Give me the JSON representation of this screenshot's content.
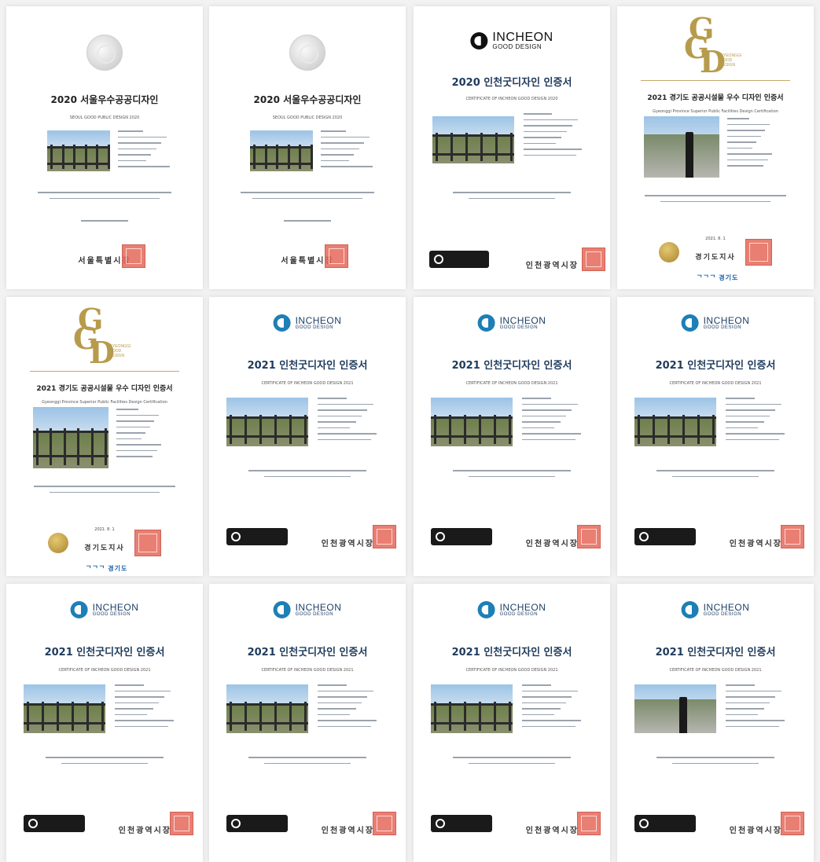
{
  "certificates": [
    {
      "kind": "seoul",
      "title": "2020 서울우수공공디자인",
      "subtitle": "SEOUL GOOD PUBLIC DESIGN 2020",
      "issuer": "서울특별시장"
    },
    {
      "kind": "seoul",
      "title": "2020 서울우수공공디자인",
      "subtitle": "SEOUL GOOD PUBLIC DESIGN 2020",
      "issuer": "서울특별시장"
    },
    {
      "kind": "incheon2020",
      "title": "2020 인천굿디자인 인증서",
      "subtitle": "CERTIFICATE OF INCHEON GOOD DESIGN 2020",
      "issuer": "인천광역시장",
      "logo": "INCHEON",
      "logo_sub": "GOOD DESIGN"
    },
    {
      "kind": "gyeonggi",
      "title": "2021 경기도 공공시설물 우수 디자인 인증서",
      "subtitle": "Gyeonggi Province Superior Public Facilities Design Certification",
      "issuer": "경기도지사",
      "date": "2021. 8. 1",
      "ggg_small": "GYEONGGI GOOD DESIGN",
      "footer_logo": "ᄀᄀᄀ 경기도",
      "photo": "bollard"
    },
    {
      "kind": "gyeonggi",
      "title": "2021 경기도 공공시설물 우수 디자인 인증서",
      "subtitle": "Gyeonggi Province Superior Public Facilities Design Certification",
      "issuer": "경기도지사",
      "date": "2021. 8. 1",
      "ggg_small": "GYEONGGI GOOD DESIGN",
      "footer_logo": "ᄀᄀᄀ 경기도",
      "photo": "fence"
    },
    {
      "kind": "incheon2021",
      "title": "2021 인천굿디자인 인증서",
      "subtitle": "CERTIFICATE OF INCHEON GOOD DESIGN 2021",
      "issuer": "인천광역시장",
      "logo": "INCHEON",
      "logo_sub": "GOOD DESIGN",
      "photo": "fence"
    },
    {
      "kind": "incheon2021",
      "title": "2021 인천굿디자인 인증서",
      "subtitle": "CERTIFICATE OF INCHEON GOOD DESIGN 2021",
      "issuer": "인천광역시장",
      "logo": "INCHEON",
      "logo_sub": "GOOD DESIGN",
      "photo": "fence"
    },
    {
      "kind": "incheon2021",
      "title": "2021 인천굿디자인 인증서",
      "subtitle": "CERTIFICATE OF INCHEON GOOD DESIGN 2021",
      "issuer": "인천광역시장",
      "logo": "INCHEON",
      "logo_sub": "GOOD DESIGN",
      "photo": "fence"
    },
    {
      "kind": "incheon2021",
      "title": "2021 인천굿디자인 인증서",
      "subtitle": "CERTIFICATE OF INCHEON GOOD DESIGN 2021",
      "issuer": "인천광역시장",
      "logo": "INCHEON",
      "logo_sub": "GOOD DESIGN",
      "photo": "fence"
    },
    {
      "kind": "incheon2021",
      "title": "2021 인천굿디자인 인증서",
      "subtitle": "CERTIFICATE OF INCHEON GOOD DESIGN 2021",
      "issuer": "인천광역시장",
      "logo": "INCHEON",
      "logo_sub": "GOOD DESIGN",
      "photo": "fence"
    },
    {
      "kind": "incheon2021",
      "title": "2021 인천굿디자인 인증서",
      "subtitle": "CERTIFICATE OF INCHEON GOOD DESIGN 2021",
      "issuer": "인천광역시장",
      "logo": "INCHEON",
      "logo_sub": "GOOD DESIGN",
      "photo": "fence"
    },
    {
      "kind": "incheon2021",
      "title": "2021 인천굿디자인 인증서",
      "subtitle": "CERTIFICATE OF INCHEON GOOD DESIGN 2021",
      "issuer": "인천광역시장",
      "logo": "INCHEON",
      "logo_sub": "GOOD DESIGN",
      "photo": "bollard"
    }
  ],
  "colors": {
    "incheon_blue": "#1d7fb5",
    "title_navy": "#1f3b5c",
    "gold": "#b79b4c",
    "stamp_red": "#e6695a"
  }
}
